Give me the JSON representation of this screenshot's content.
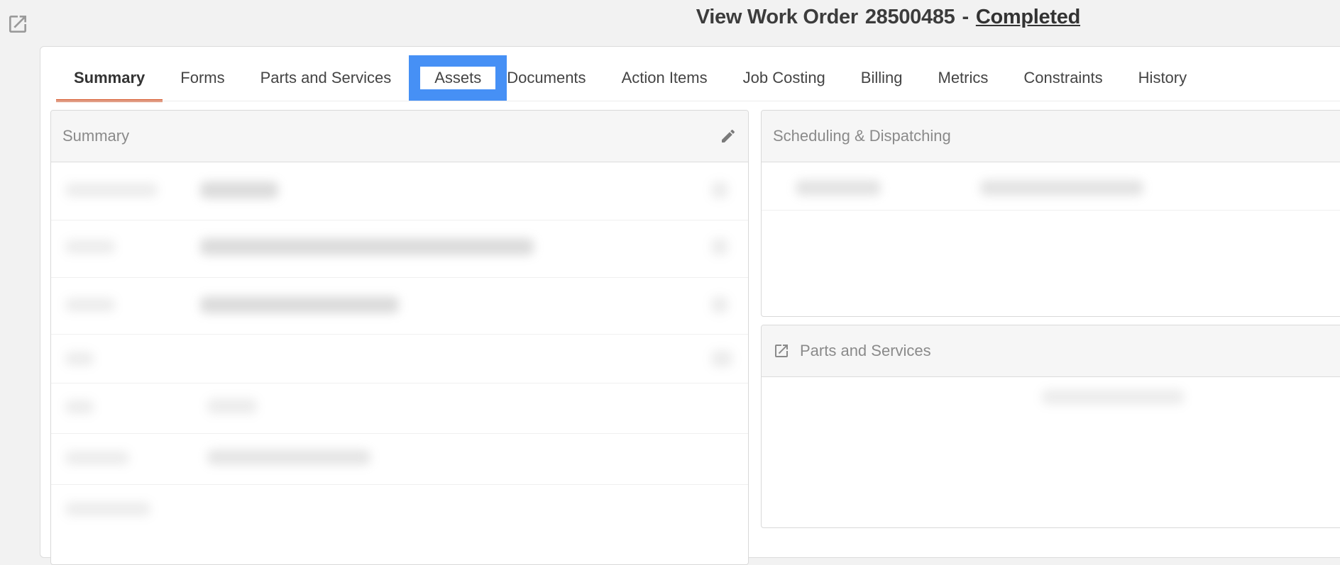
{
  "header": {
    "title": "View Work Order",
    "work_order_number": "28500485",
    "separator": "-",
    "status": "Completed"
  },
  "tabs": [
    {
      "label": "Summary",
      "active": true
    },
    {
      "label": "Forms"
    },
    {
      "label": "Parts and Services"
    },
    {
      "label": "Assets",
      "highlighted": true
    },
    {
      "label": "Documents"
    },
    {
      "label": "Action Items"
    },
    {
      "label": "Job Costing"
    },
    {
      "label": "Billing"
    },
    {
      "label": "Metrics"
    },
    {
      "label": "Constraints"
    },
    {
      "label": "History"
    }
  ],
  "panels": {
    "summary": {
      "title": "Summary",
      "icon": "pencil-icon"
    },
    "scheduling": {
      "title": "Scheduling & Dispatching"
    },
    "parts": {
      "title": "Parts and Services",
      "icon": "external-link-icon"
    }
  },
  "colors": {
    "active_tab_underline": "#d9643c",
    "highlight_box": "#4690f5",
    "background": "#f2f2f2"
  }
}
